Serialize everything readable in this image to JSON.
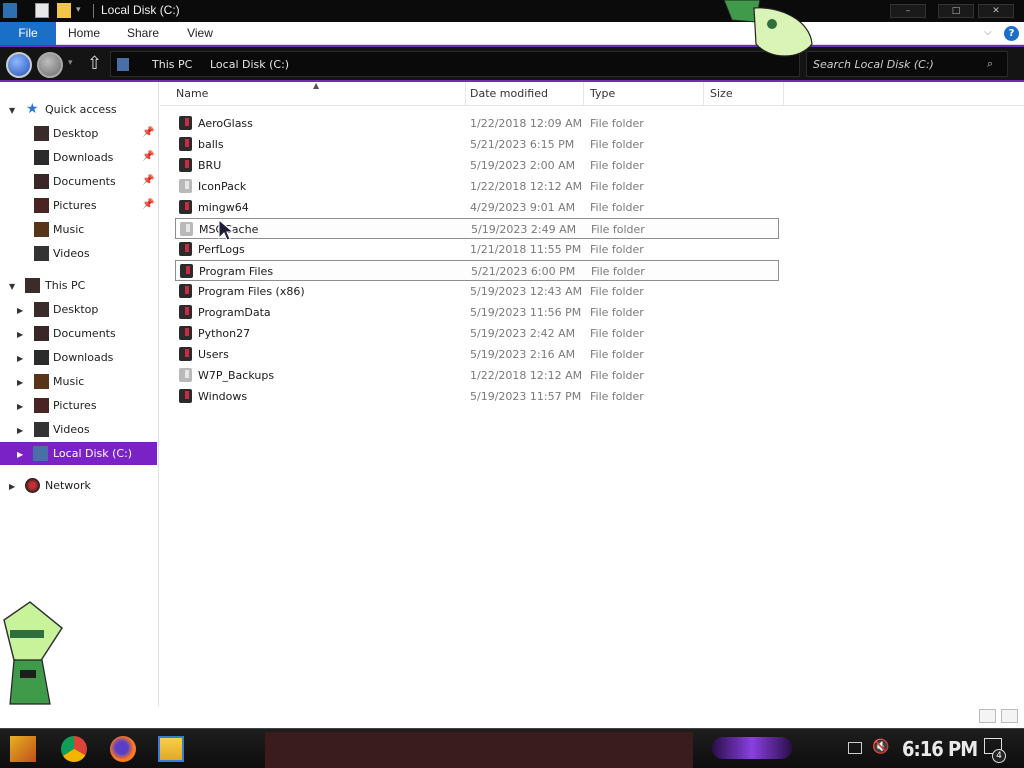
{
  "window": {
    "title": "Local Disk (C:)",
    "controls": {
      "minimize": "–",
      "maximize": "□",
      "close": "✕"
    }
  },
  "ribbon": {
    "tabs": [
      {
        "label": "File"
      },
      {
        "label": "Home"
      },
      {
        "label": "Share"
      },
      {
        "label": "View"
      }
    ],
    "expand_icon": "chevron-down-icon",
    "help_icon": "help-icon",
    "help_label": "?"
  },
  "address": {
    "crumbs": [
      "This PC",
      "Local Disk (C:)"
    ]
  },
  "search": {
    "placeholder": "Search Local Disk (C:)"
  },
  "nav": {
    "quick_access": "Quick access",
    "quick_items": [
      "Desktop",
      "Downloads",
      "Documents",
      "Pictures",
      "Music",
      "Videos"
    ],
    "this_pc": "This PC",
    "pc_items": [
      "Desktop",
      "Documents",
      "Downloads",
      "Music",
      "Pictures",
      "Videos",
      "Local Disk (C:)"
    ],
    "network": "Network"
  },
  "list": {
    "columns": [
      "Name",
      "Date modified",
      "Type",
      "Size"
    ],
    "rows": [
      {
        "name": "AeroGlass",
        "date": "1/22/2018 12:09 AM",
        "type": "File folder"
      },
      {
        "name": "balls",
        "date": "5/21/2023 6:15 PM",
        "type": "File folder"
      },
      {
        "name": "BRU",
        "date": "5/19/2023 2:00 AM",
        "type": "File folder"
      },
      {
        "name": "IconPack",
        "date": "1/22/2018 12:12 AM",
        "type": "File folder"
      },
      {
        "name": "mingw64",
        "date": "4/29/2023 9:01 AM",
        "type": "File folder"
      },
      {
        "name": "MSOCache",
        "date": "5/19/2023 2:49 AM",
        "type": "File folder"
      },
      {
        "name": "PerfLogs",
        "date": "1/21/2018 11:55 PM",
        "type": "File folder"
      },
      {
        "name": "Program Files",
        "date": "5/21/2023 6:00 PM",
        "type": "File folder"
      },
      {
        "name": "Program Files (x86)",
        "date": "5/19/2023 12:43 AM",
        "type": "File folder"
      },
      {
        "name": "ProgramData",
        "date": "5/19/2023 11:56 PM",
        "type": "File folder"
      },
      {
        "name": "Python27",
        "date": "5/19/2023 2:42 AM",
        "type": "File folder"
      },
      {
        "name": "Users",
        "date": "5/19/2023 2:16 AM",
        "type": "File folder"
      },
      {
        "name": "W7P_Backups",
        "date": "1/22/2018 12:12 AM",
        "type": "File folder"
      },
      {
        "name": "Windows",
        "date": "5/19/2023 11:57 PM",
        "type": "File folder"
      }
    ]
  },
  "taskbar": {
    "clock": "6:16 PM",
    "notification_count": "4"
  },
  "colors": {
    "accent": "#7b22c7",
    "ribbon_file": "#1a6fc9",
    "folder_mark": "#c62c44"
  }
}
